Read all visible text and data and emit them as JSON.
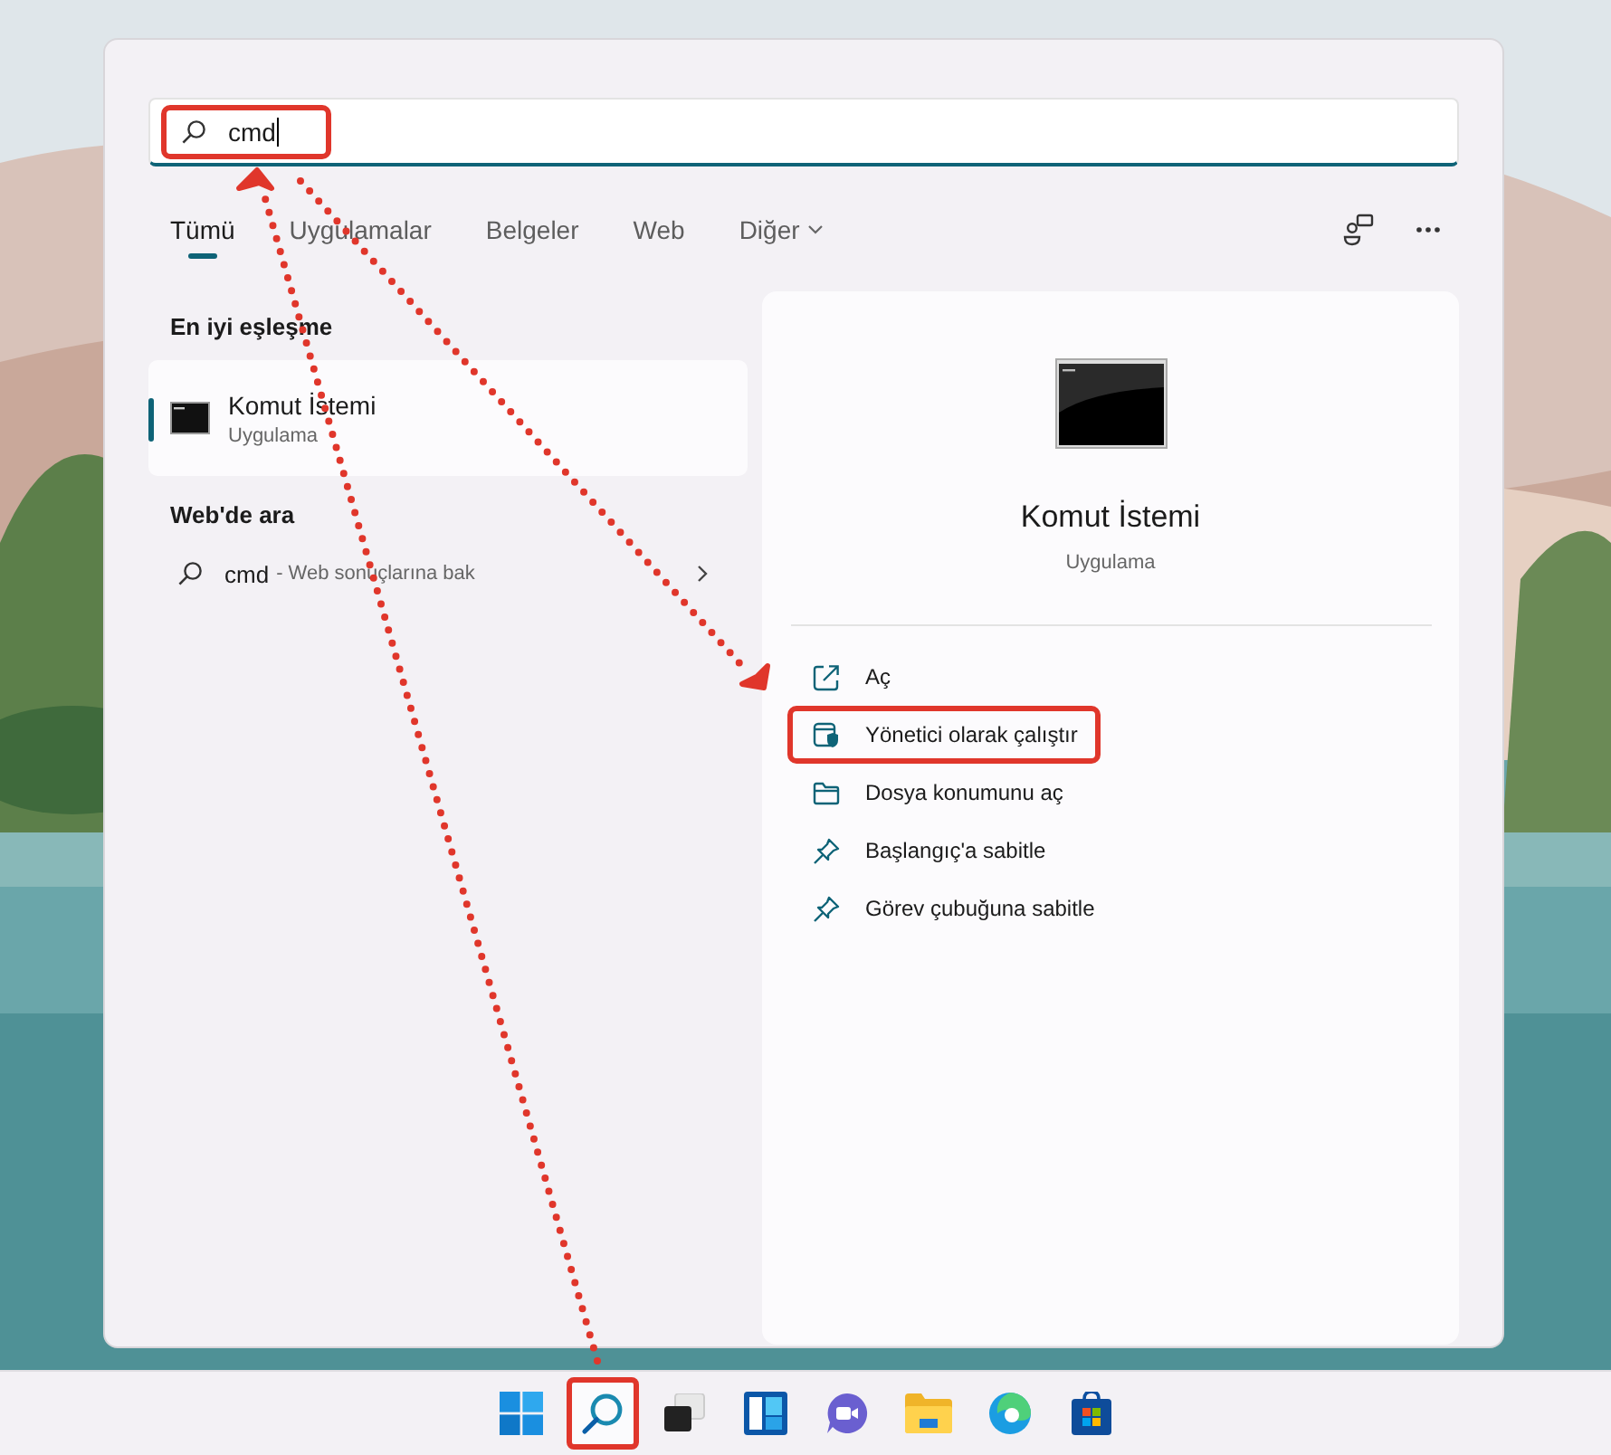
{
  "search": {
    "value": "cmd",
    "highlighted": true
  },
  "tabs": [
    {
      "label": "Tümü",
      "selected": true,
      "has_menu": false
    },
    {
      "label": "Uygulamalar",
      "selected": false,
      "has_menu": false
    },
    {
      "label": "Belgeler",
      "selected": false,
      "has_menu": false
    },
    {
      "label": "Web",
      "selected": false,
      "has_menu": false
    },
    {
      "label": "Diğer",
      "selected": false,
      "has_menu": true
    }
  ],
  "best_match": {
    "heading": "En iyi eşleşme",
    "item": {
      "title": "Komut İstemi",
      "subtitle": "Uygulama",
      "selected": true
    }
  },
  "web_search": {
    "heading": "Web'de ara",
    "item": {
      "query": "cmd",
      "hint": "- Web sonuçlarına bak"
    }
  },
  "detail": {
    "title": "Komut İstemi",
    "subtitle": "Uygulama",
    "actions": [
      {
        "label": "Aç",
        "kind": "open",
        "highlighted": false
      },
      {
        "label": "Yönetici olarak çalıştır",
        "kind": "admin",
        "highlighted": true
      },
      {
        "label": "Dosya konumunu aç",
        "kind": "folder",
        "highlighted": false
      },
      {
        "label": "Başlangıç'a sabitle",
        "kind": "pin",
        "highlighted": false
      },
      {
        "label": "Görev çubuğuna sabitle",
        "kind": "pin",
        "highlighted": false
      }
    ]
  },
  "taskbar": [
    {
      "kind": "start",
      "highlighted": false
    },
    {
      "kind": "search",
      "highlighted": true
    },
    {
      "kind": "taskview",
      "highlighted": false
    },
    {
      "kind": "widgets",
      "highlighted": false
    },
    {
      "kind": "chat",
      "highlighted": false
    },
    {
      "kind": "explorer",
      "highlighted": false
    },
    {
      "kind": "edge",
      "highlighted": false
    },
    {
      "kind": "store",
      "highlighted": false
    }
  ]
}
